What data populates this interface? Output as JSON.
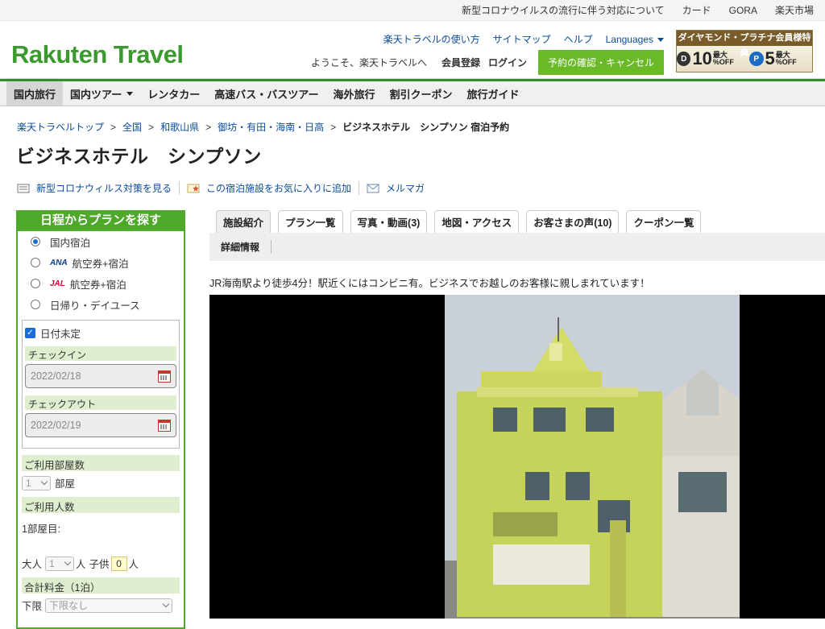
{
  "utilbar": {
    "links": [
      "新型コロナウイルスの流行に伴う対応について",
      "カード",
      "GORA",
      "楽天市場"
    ]
  },
  "header": {
    "logo": "Rakuten Travel",
    "links": [
      "楽天トラベルの使い方",
      "サイトマップ",
      "ヘルプ"
    ],
    "languages": "Languages",
    "welcome": "ようこそ、楽天トラベルへ",
    "register": "会員登録",
    "login": "ログイン",
    "reservation_button": "予約の確認・キャンセル",
    "banner": {
      "title": "ダイヤモンド・プラチナ会員様特典",
      "offer1": {
        "icon": "D",
        "value": "10",
        "label": "最大 %OFF"
      },
      "offer2": {
        "icon": "P",
        "value": "5",
        "label": "最大 %OFF"
      }
    }
  },
  "nav": {
    "items": [
      "国内旅行",
      "国内ツアー",
      "レンタカー",
      "高速バス・バスツアー",
      "海外旅行",
      "割引クーポン",
      "旅行ガイド"
    ]
  },
  "breadcrumb": {
    "items": [
      "楽天トラベルトップ",
      "全国",
      "和歌山県",
      "御坊・有田・海南・日高"
    ],
    "current": "ビジネスホテル　シンプソン 宿泊予約"
  },
  "page_title": "ビジネスホテル　シンプソン",
  "actions": {
    "covid": "新型コロナウィルス対策を見る",
    "favorite": "この宿泊施設をお気に入りに追加",
    "mailmag": "メルマガ"
  },
  "sidebar": {
    "title": "日程からプランを探す",
    "options": [
      {
        "label": "国内宿泊",
        "checked": true,
        "airline": ""
      },
      {
        "label": "航空券+宿泊",
        "checked": false,
        "airline": "ANA"
      },
      {
        "label": "航空券+宿泊",
        "checked": false,
        "airline": "JAL"
      },
      {
        "label": "日帰り・デイユース",
        "checked": false,
        "airline": ""
      }
    ],
    "date_undecided": "日付未定",
    "checkin_label": "チェックイン",
    "checkin_value": "2022/02/18",
    "checkout_label": "チェックアウト",
    "checkout_value": "2022/02/19",
    "rooms_label": "ご利用部屋数",
    "rooms_value": "1",
    "rooms_unit": "部屋",
    "guests_label": "ご利用人数",
    "room1_label": "1部屋目:",
    "adult_label": "大人",
    "adult_value": "1",
    "adult_unit": "人",
    "child_label": "子供",
    "child_value": "0",
    "child_unit": "人",
    "price_label": "合計料金（1泊）",
    "min_label": "下限",
    "min_value": "下限なし"
  },
  "tabs": {
    "items": [
      "施設紹介",
      "プラン一覧",
      "写真・動画(3)",
      "地図・アクセス",
      "お客さまの声(10)",
      "クーポン一覧"
    ],
    "subtab": "詳細情報"
  },
  "description": "JR海南駅より徒歩4分！駅近くにはコンビニ有。ビジネスでお越しのお客様に親しまれています！",
  "colors": {
    "brand": "#3a9a2e",
    "nav_accent": "#2f8f2f",
    "sidebar": "#4ea82a",
    "reserve_button": "#6aba28"
  }
}
